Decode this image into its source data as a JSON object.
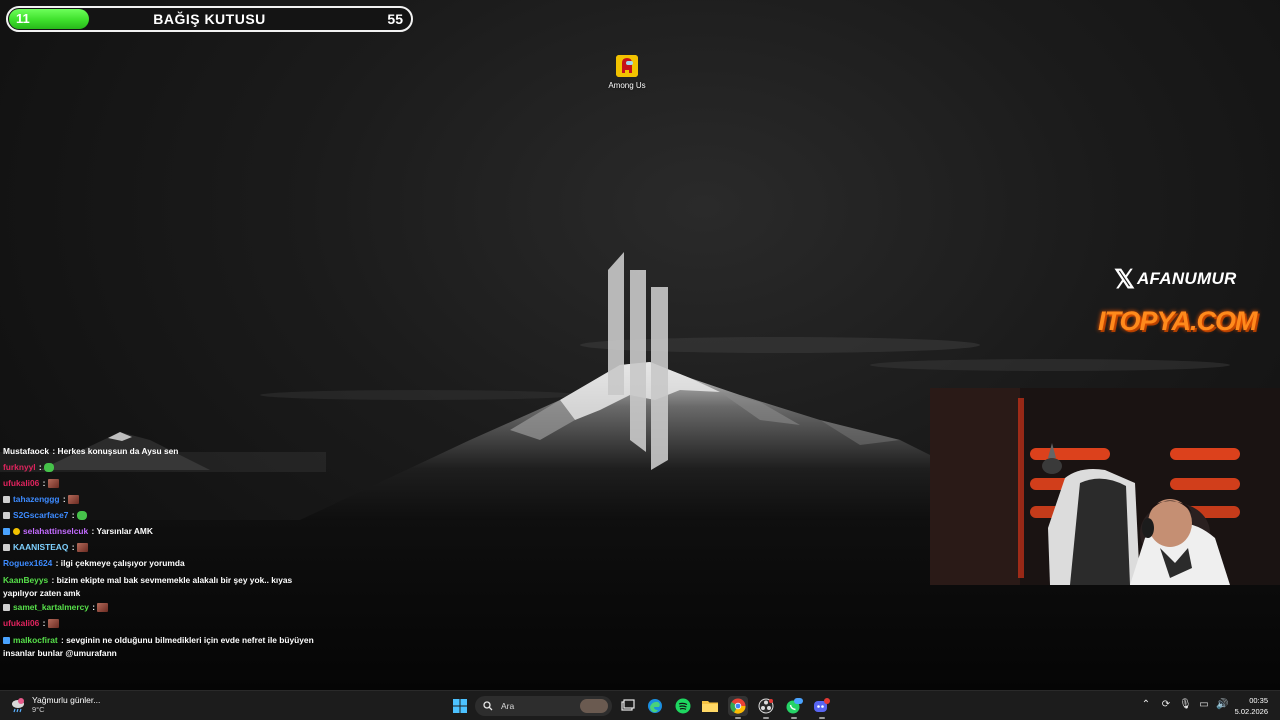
{
  "donation": {
    "current": "11",
    "title": "BAĞIŞ KUTUSU",
    "goal": "55",
    "progress_fraction": 0.2
  },
  "desktop": {
    "icons": [
      {
        "label": "Among Us",
        "icon": "among-us-icon"
      }
    ]
  },
  "overlay": {
    "x_handle": "AFANUMUR",
    "sponsor": "ITOPYA.COM"
  },
  "chat": {
    "messages": [
      {
        "user": "Mustafaock",
        "color": "#ffffff",
        "text": " : Herkes konuşsun da Aysu sen",
        "emote": ""
      },
      {
        "user": "furknyyl",
        "color": "#e0245e",
        "text": " : ",
        "emote": "green-leaf"
      },
      {
        "user": "ufukali06",
        "color": "#e0245e",
        "text": " : ",
        "emote": "face"
      },
      {
        "user": "tahazenggg",
        "color": "#3d8bff",
        "text": " : ",
        "emote": "face",
        "badge": "#cfcfcf"
      },
      {
        "user": "S2Gscarface7",
        "color": "#3d8bff",
        "text": " : ",
        "emote": "green-blob"
      },
      {
        "user": "selahattinselcuk",
        "color": "#c36bff",
        "text": " : Yarsınlar AMK",
        "emote": "",
        "badge": "#4aa3ff"
      },
      {
        "user": "KAANISTEAQ",
        "color": "#7fd1ff",
        "text": " : ",
        "emote": "face",
        "badge": "#cfcfcf"
      },
      {
        "user": "Roguex1624",
        "color": "#3d8bff",
        "text": " : ilgi çekmeye çalışıyor yorumda",
        "emote": ""
      },
      {
        "user": "KaanBeyys",
        "color": "#57e04a",
        "text": " : bizim ekipte mal bak sevmemekle alakalı bir şey yok.. kıyas yapılıyor zaten amk",
        "emote": ""
      },
      {
        "user": "samet_kartalmercy",
        "color": "#57e04a",
        "text": " : ",
        "emote": "face",
        "badge": "#cfcfcf"
      },
      {
        "user": "ufukali06",
        "color": "#e0245e",
        "text": " : ",
        "emote": "face"
      },
      {
        "user": "malkocfirat",
        "color": "#57e04a",
        "text": " : sevginin ne olduğunu bilmedikleri için evde nefret ile büyüyen insanlar bunlar @umurafann",
        "emote": "",
        "badge": "#4aa3ff"
      }
    ]
  },
  "taskbar": {
    "weather_label": "Yağmurlu günler...",
    "weather_temp": "9°C",
    "search_placeholder": "Ara",
    "time": "00:35",
    "date": "5.02.2026",
    "apps": [
      "windows-start-icon",
      "search-icon",
      "task-view-icon",
      "edge-icon",
      "spotify-icon",
      "file-explorer-icon",
      "chrome-icon",
      "obs-icon",
      "whatsapp-icon",
      "discord-icon"
    ]
  },
  "colors": {
    "progress_green": "#3ee02c",
    "sponsor_orange": "#ff8a1c",
    "taskbar_bg": "#1c1c1c"
  }
}
